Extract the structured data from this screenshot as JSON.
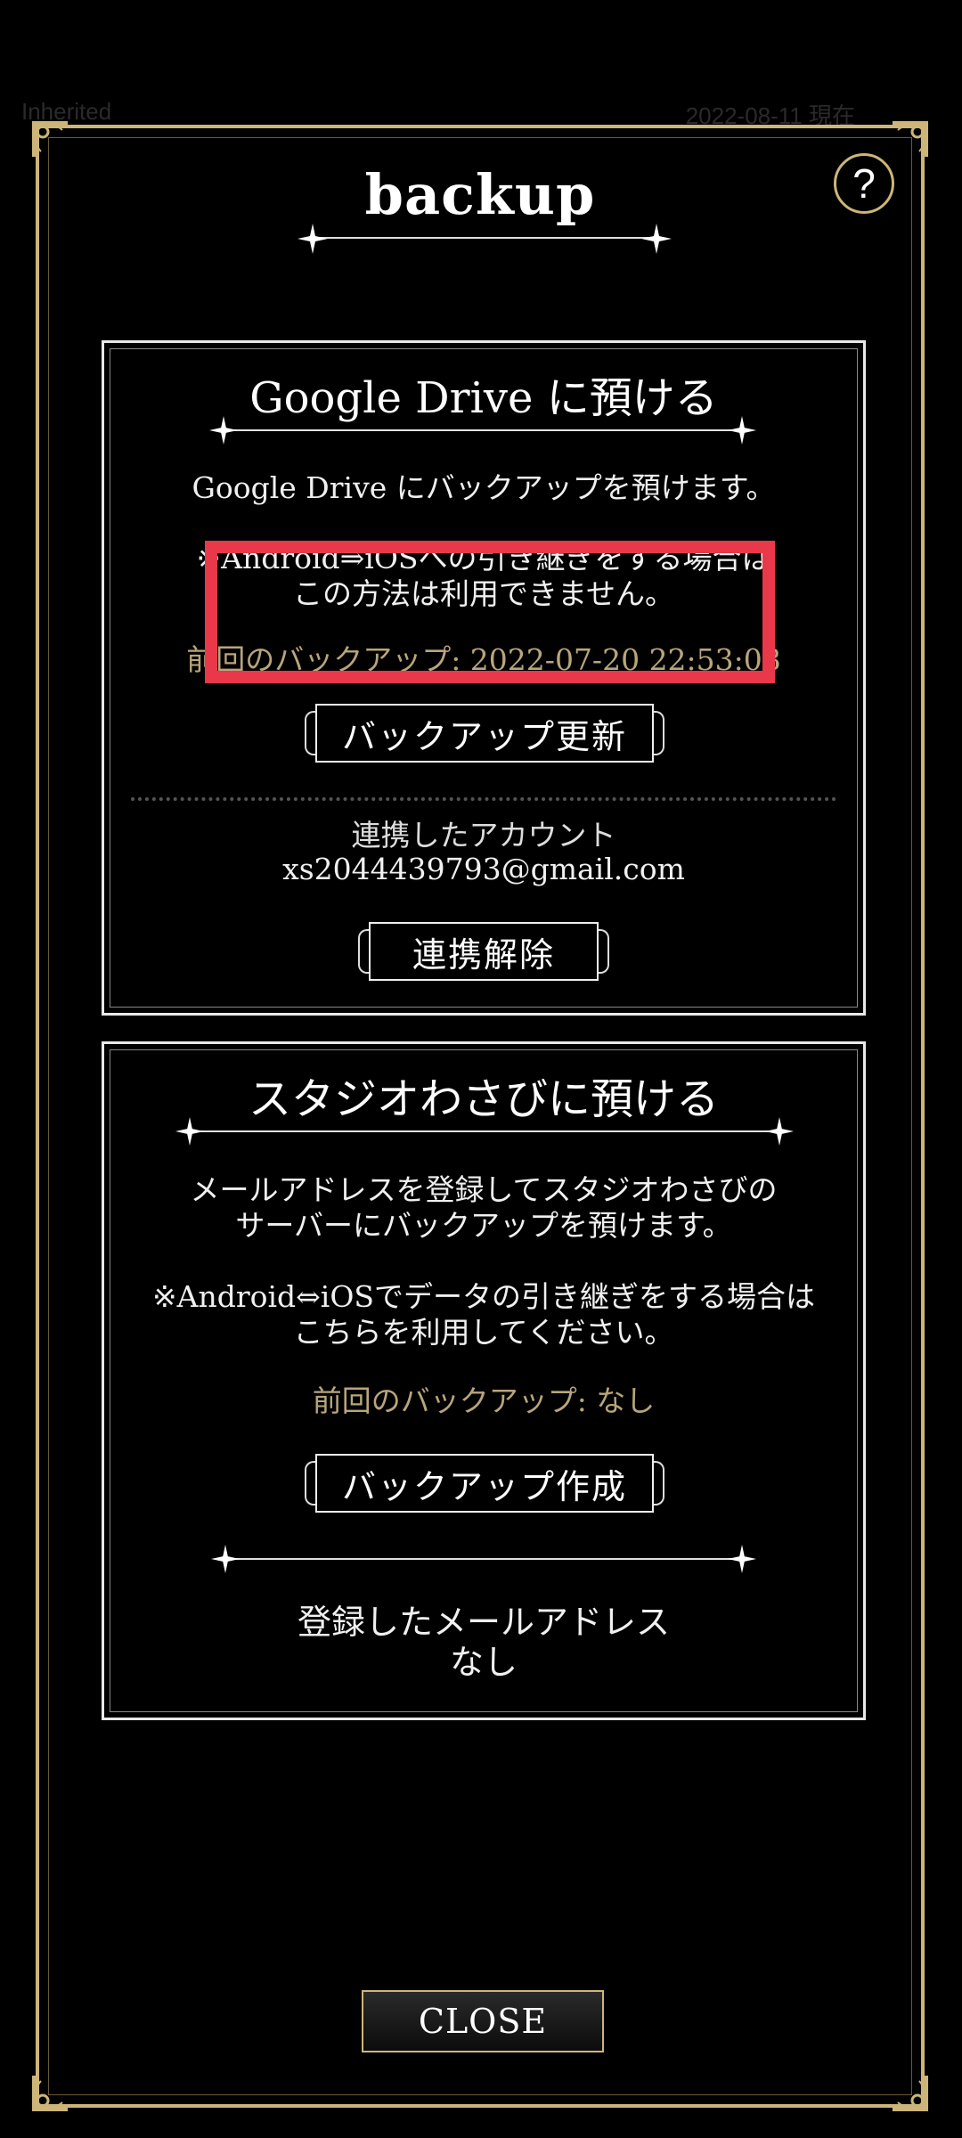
{
  "background": {
    "left_text": "Inherited",
    "right_text": "2022-08-11 現在"
  },
  "dialog": {
    "title": "backup",
    "help_icon_text": "?",
    "close_label": "CLOSE"
  },
  "google_drive": {
    "title": "Google Drive に預ける",
    "description": "Google Drive にバックアップを預けます。",
    "note_line1": "※Android⇒iOSへの引き継ぎをする場合は",
    "note_line2": "この方法は利用できません。",
    "last_backup": "前回のバックアップ: 2022-07-20 22:53:08",
    "update_button": "バックアップ更新",
    "linked_account_label": "連携したアカウント",
    "linked_account_email": "xs2044439793@gmail.com",
    "unlink_button": "連携解除"
  },
  "wasabi": {
    "title": "スタジオわさびに預ける",
    "description_line1": "メールアドレスを登録してスタジオわさびの",
    "description_line2": "サーバーにバックアップを預けます。",
    "note_line1": "※Android⇔iOSでデータの引き継ぎをする場合は",
    "note_line2": "こちらを利用してください。",
    "last_backup": "前回のバックアップ: なし",
    "create_button": "バックアップ作成",
    "registered_email_label": "登録したメールアドレス",
    "registered_email_value": "なし"
  },
  "colors": {
    "frame_gold": "#cdb57a",
    "highlight_red": "#e8384a",
    "muted_gold_text": "#b8a57a"
  }
}
